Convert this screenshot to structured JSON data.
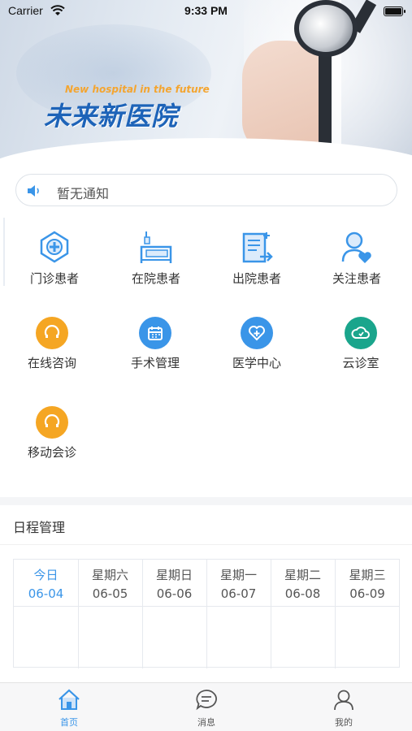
{
  "status_bar": {
    "carrier": "Carrier",
    "time": "9:33 PM"
  },
  "hero": {
    "subtitle": "New hospital in the future",
    "title": "未来新医院"
  },
  "notice": {
    "text": "暂无通知",
    "icon": "speaker-icon"
  },
  "patients": [
    {
      "label": "门诊患者",
      "icon": "outpatient-icon"
    },
    {
      "label": "在院患者",
      "icon": "hospital-bed-icon"
    },
    {
      "label": "出院患者",
      "icon": "discharge-icon"
    },
    {
      "label": "关注患者",
      "icon": "follow-patient-icon"
    }
  ],
  "services": [
    {
      "label": "在线咨询",
      "icon": "consult-icon",
      "color": "#f5a623"
    },
    {
      "label": "手术管理",
      "icon": "calendar-icon",
      "color": "#3a95e8"
    },
    {
      "label": "医学中心",
      "icon": "medical-center-icon",
      "color": "#3a95e8"
    },
    {
      "label": "云诊室",
      "icon": "cloud-clinic-icon",
      "color": "#1aa58c"
    },
    {
      "label": "移动会诊",
      "icon": "mobile-consult-icon",
      "color": "#f5a623"
    }
  ],
  "schedule": {
    "title": "日程管理",
    "days": [
      {
        "weekday": "今日",
        "date": "06-04"
      },
      {
        "weekday": "星期六",
        "date": "06-05"
      },
      {
        "weekday": "星期日",
        "date": "06-06"
      },
      {
        "weekday": "星期一",
        "date": "06-07"
      },
      {
        "weekday": "星期二",
        "date": "06-08"
      },
      {
        "weekday": "星期三",
        "date": "06-09"
      }
    ]
  },
  "tabbar": [
    {
      "label": "首页",
      "icon": "home-icon",
      "active": true
    },
    {
      "label": "消息",
      "icon": "message-icon",
      "active": false
    },
    {
      "label": "我的",
      "icon": "profile-icon",
      "active": false
    }
  ],
  "colors": {
    "accent": "#3a95e8",
    "orange": "#f5a623",
    "teal": "#1aa58c"
  }
}
